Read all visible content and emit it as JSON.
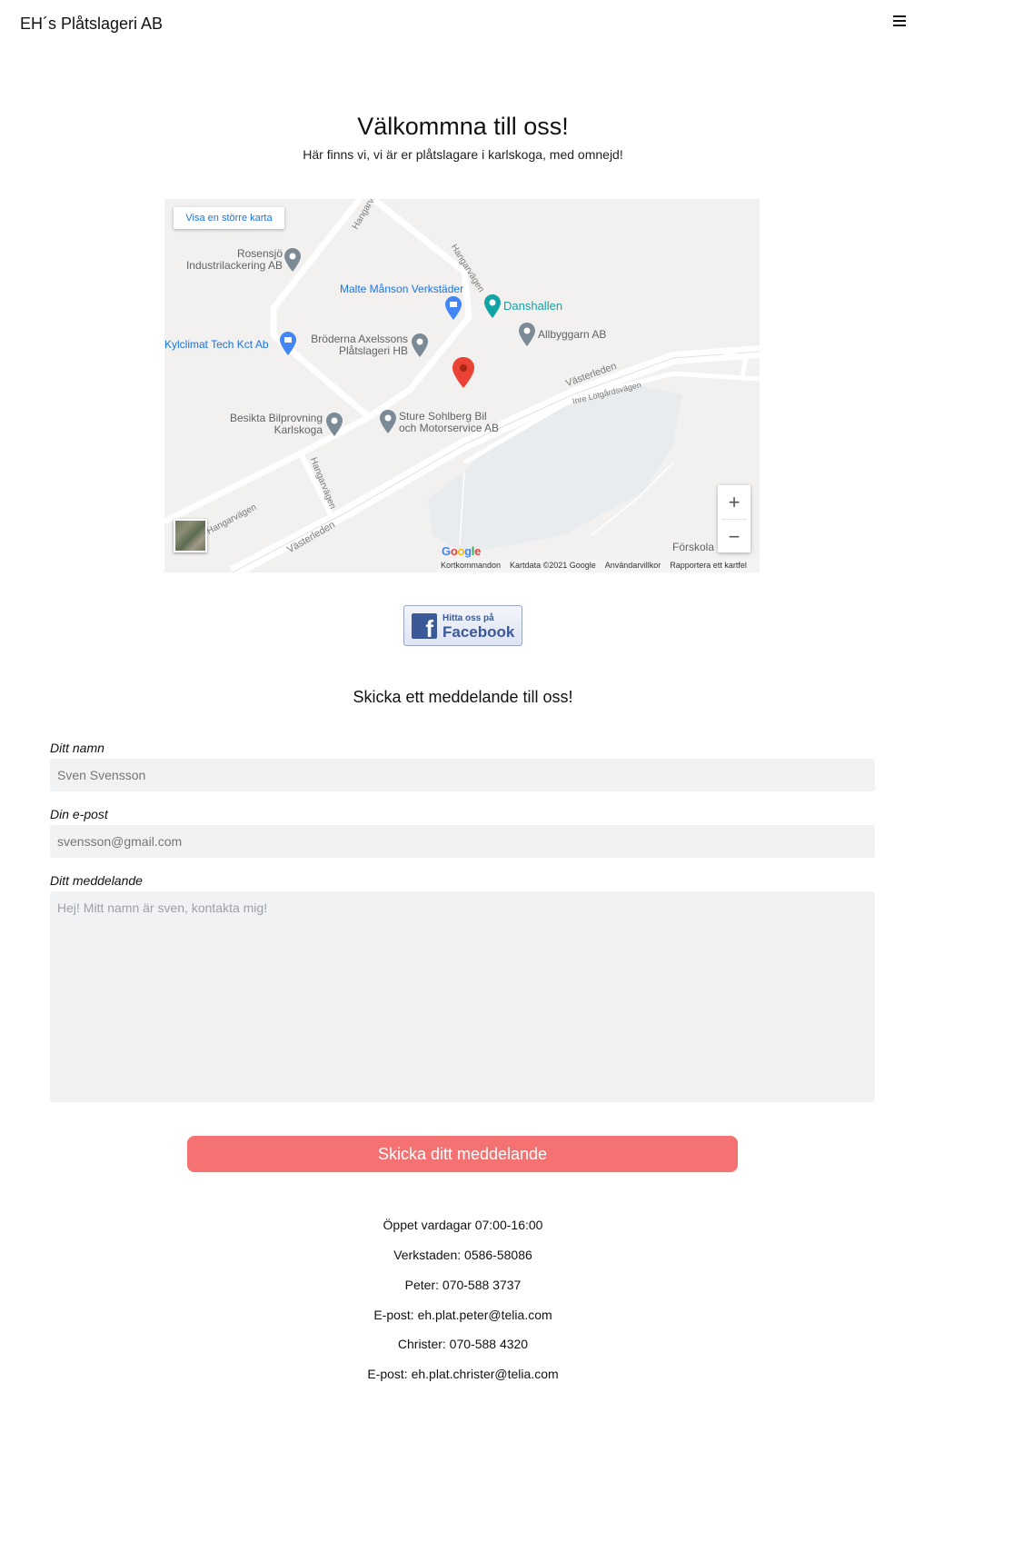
{
  "header": {
    "brand": "EH´s Plåtslageri AB",
    "menu_icon": "hamburger-menu-icon"
  },
  "hero": {
    "title": "Välkommna till oss!",
    "subtitle": "Här finns vi, vi är er plåtslagare i karlskoga, med omnejd!"
  },
  "map": {
    "larger_map_link": "Visa en större karta",
    "pois": {
      "rosensjo": [
        "Rosensjö",
        "Industrilackering AB"
      ],
      "malte": "Malte Månson Verkstäder",
      "danshallen": "Danshallen",
      "allbyggarn": "Allbyggarn AB",
      "kylclimat": "Kylclimat Tech Kct Ab",
      "broderna": [
        "Bröderna Axelssons",
        "Plåtslageri HB"
      ],
      "besikta": [
        "Besikta Bilprovning",
        "Karlskoga"
      ],
      "sture": [
        "Sture Sohlberg Bil",
        "och Motorservice AB"
      ],
      "forskola": "Förskola"
    },
    "roads": {
      "hangarvagen": "Hangarvägen",
      "vasterleden": "Västerleden",
      "inre_lotgardsvagen": "Inre Lötgårdsvägen"
    },
    "zoom_in": "+",
    "zoom_out": "−",
    "google_logo": "Google",
    "footer": {
      "shortcuts": "Kortkommandon",
      "map_data": "Kartdata ©2021 Google",
      "terms": "Användarvillkor",
      "report": "Rapportera ett kartfel"
    }
  },
  "facebook": {
    "small": "Hitta oss på",
    "big": "Facebook",
    "logo_letter": "f"
  },
  "contact": {
    "title": "Skicka ett meddelande till oss!",
    "name_label": "Ditt namn",
    "name_placeholder": "Sven Svensson",
    "email_label": "Din e-post",
    "email_placeholder": "svensson@gmail.com",
    "message_label": "Ditt meddelande",
    "message_placeholder": "Hej! Mitt namn är sven, kontakta mig!",
    "submit": "Skicka ditt meddelande"
  },
  "info": {
    "hours": "Öppet vardagar 07:00-16:00",
    "workshop": "Verkstaden: 0586-58086",
    "peter": "Peter: 070-588 3737",
    "peter_email": "E-post: eh.plat.peter@telia.com",
    "christer": "Christer: 070-588 4320",
    "christer_email": "E-post: eh.plat.christer@telia.com"
  }
}
